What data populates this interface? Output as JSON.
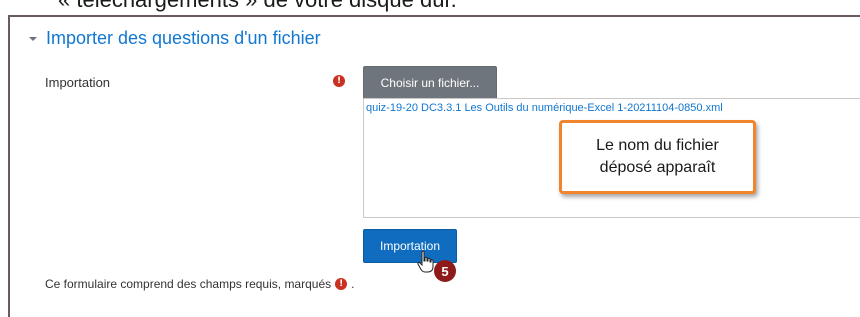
{
  "caption": {
    "text": "« téléchargements » de votre disque dur."
  },
  "section": {
    "title": "Importer des questions d'un fichier"
  },
  "import_field": {
    "label": "Importation",
    "required_glyph": "!",
    "choose_button": "Choisir un fichier...",
    "file_name": "quiz-19-20 DC3.3.1 Les Outils du numérique-Excel 1-20211104-0850.xml"
  },
  "callout": {
    "line1": "Le nom du fichier",
    "line2": "déposé apparaît"
  },
  "actions": {
    "submit_label": "Importation"
  },
  "step_badge": {
    "number": "5"
  },
  "footer": {
    "required_note": "Ce formulaire comprend des champs requis, marqués",
    "required_glyph": "!",
    "period": "."
  },
  "colors": {
    "link_blue": "#1177d1",
    "primary_button": "#0f6cbf",
    "secondary_button": "#6f757c",
    "required_red": "#ca3120",
    "callout_border": "#f0852d",
    "step_badge": "#8e1a1a"
  },
  "icons": {
    "collapse": "chevron-down-icon",
    "required": "exclamation-circle-icon",
    "cursor": "hand-pointer-icon"
  }
}
